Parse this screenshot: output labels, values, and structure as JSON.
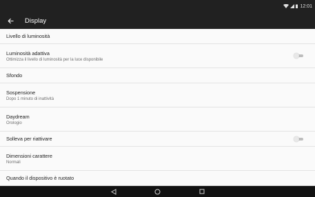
{
  "status_bar": {
    "time": "12:01"
  },
  "toolbar": {
    "title": "Display"
  },
  "settings": [
    {
      "title": "Livello di luminosità",
      "subtitle": "",
      "toggle": false
    },
    {
      "title": "Luminosità adattiva",
      "subtitle": "Ottimizza il livello di luminosità per la luce disponibile",
      "toggle": true,
      "toggle_state": "off"
    },
    {
      "title": "Sfondo",
      "subtitle": "",
      "toggle": false
    },
    {
      "title": "Sospensione",
      "subtitle": "Dopo 1 minuto di inattività",
      "toggle": false
    },
    {
      "title": "Daydream",
      "subtitle": "Orologio",
      "toggle": false
    },
    {
      "title": "Solleva per riattivare",
      "subtitle": "",
      "toggle": true,
      "toggle_state": "off"
    },
    {
      "title": "Dimensioni carattere",
      "subtitle": "Normali",
      "toggle": false
    },
    {
      "title": "Quando il dispositivo è ruotato",
      "subtitle": "",
      "toggle": false
    }
  ],
  "nav_bar": {
    "icons": [
      "back-triangle-icon",
      "home-circle-icon",
      "recents-square-icon"
    ]
  },
  "colors": {
    "bars": "#212121",
    "background": "#fafafa",
    "toggle_off": "#bdbdbd"
  }
}
